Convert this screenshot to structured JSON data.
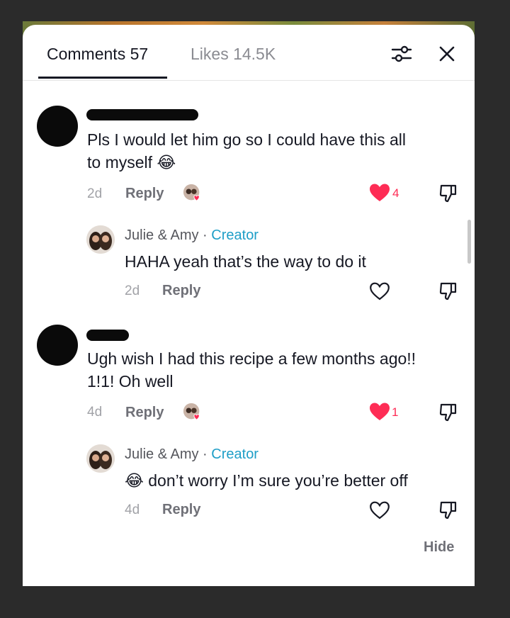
{
  "header": {
    "tabs": [
      {
        "label": "Comments 57"
      },
      {
        "label": "Likes 14.5K"
      }
    ],
    "filter_icon": "sliders-icon",
    "close_icon": "close-icon"
  },
  "comments": [
    {
      "text_line1": "Pls I would let him go so I could have this all",
      "text_line2": "to myself 😂",
      "date": "2d",
      "reply": "Reply",
      "likes": "4",
      "liked": true,
      "reply_item": {
        "author": "Julie & Amy",
        "separator": "·",
        "badge": "Creator",
        "text": "HAHA yeah that’s the way to do it",
        "date": "2d",
        "reply": "Reply"
      }
    },
    {
      "text_line1": "Ugh wish I had this recipe a few months ago!!",
      "text_line2": "1!1! Oh well",
      "date": "4d",
      "reply": "Reply",
      "likes": "1",
      "liked": true,
      "reply_item": {
        "author": "Julie & Amy",
        "separator": "·",
        "badge": "Creator",
        "text": "😂 don’t worry I’m sure you’re better off",
        "date": "4d",
        "reply": "Reply"
      }
    }
  ],
  "footer": {
    "hide_label": "Hide"
  },
  "colors": {
    "accent_like": "#fe2c55",
    "creator": "#1e9ec7"
  }
}
